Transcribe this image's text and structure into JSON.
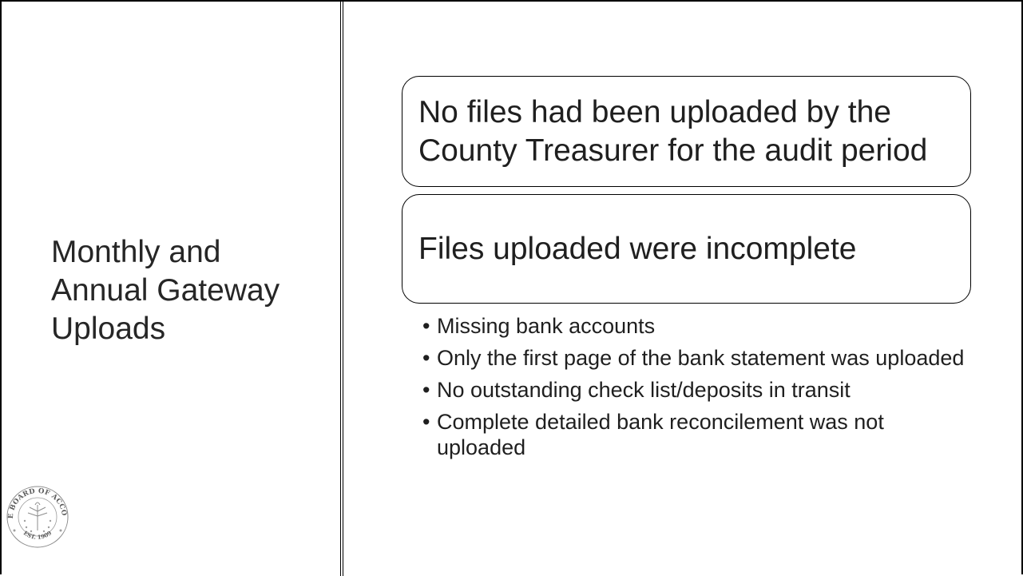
{
  "title": {
    "lines": [
      "Monthly and",
      "Annual Gateway",
      "Uploads"
    ]
  },
  "boxes": [
    "No files had been uploaded by the County Treasurer for the audit period",
    "Files uploaded were incomplete"
  ],
  "bullets": [
    "Missing bank accounts",
    "Only the first page of the bank statement was uploaded",
    "No outstanding check list/deposits in transit",
    "Complete detailed bank reconcilement was not uploaded"
  ],
  "seal": {
    "text_top": "STATE BOARD OF ACCOUNTS",
    "text_bottom": "EST. 1909",
    "icon": "state-seal-logo"
  },
  "colors": {
    "text": "#1f1f1f",
    "border": "#000000",
    "background": "#ffffff"
  }
}
